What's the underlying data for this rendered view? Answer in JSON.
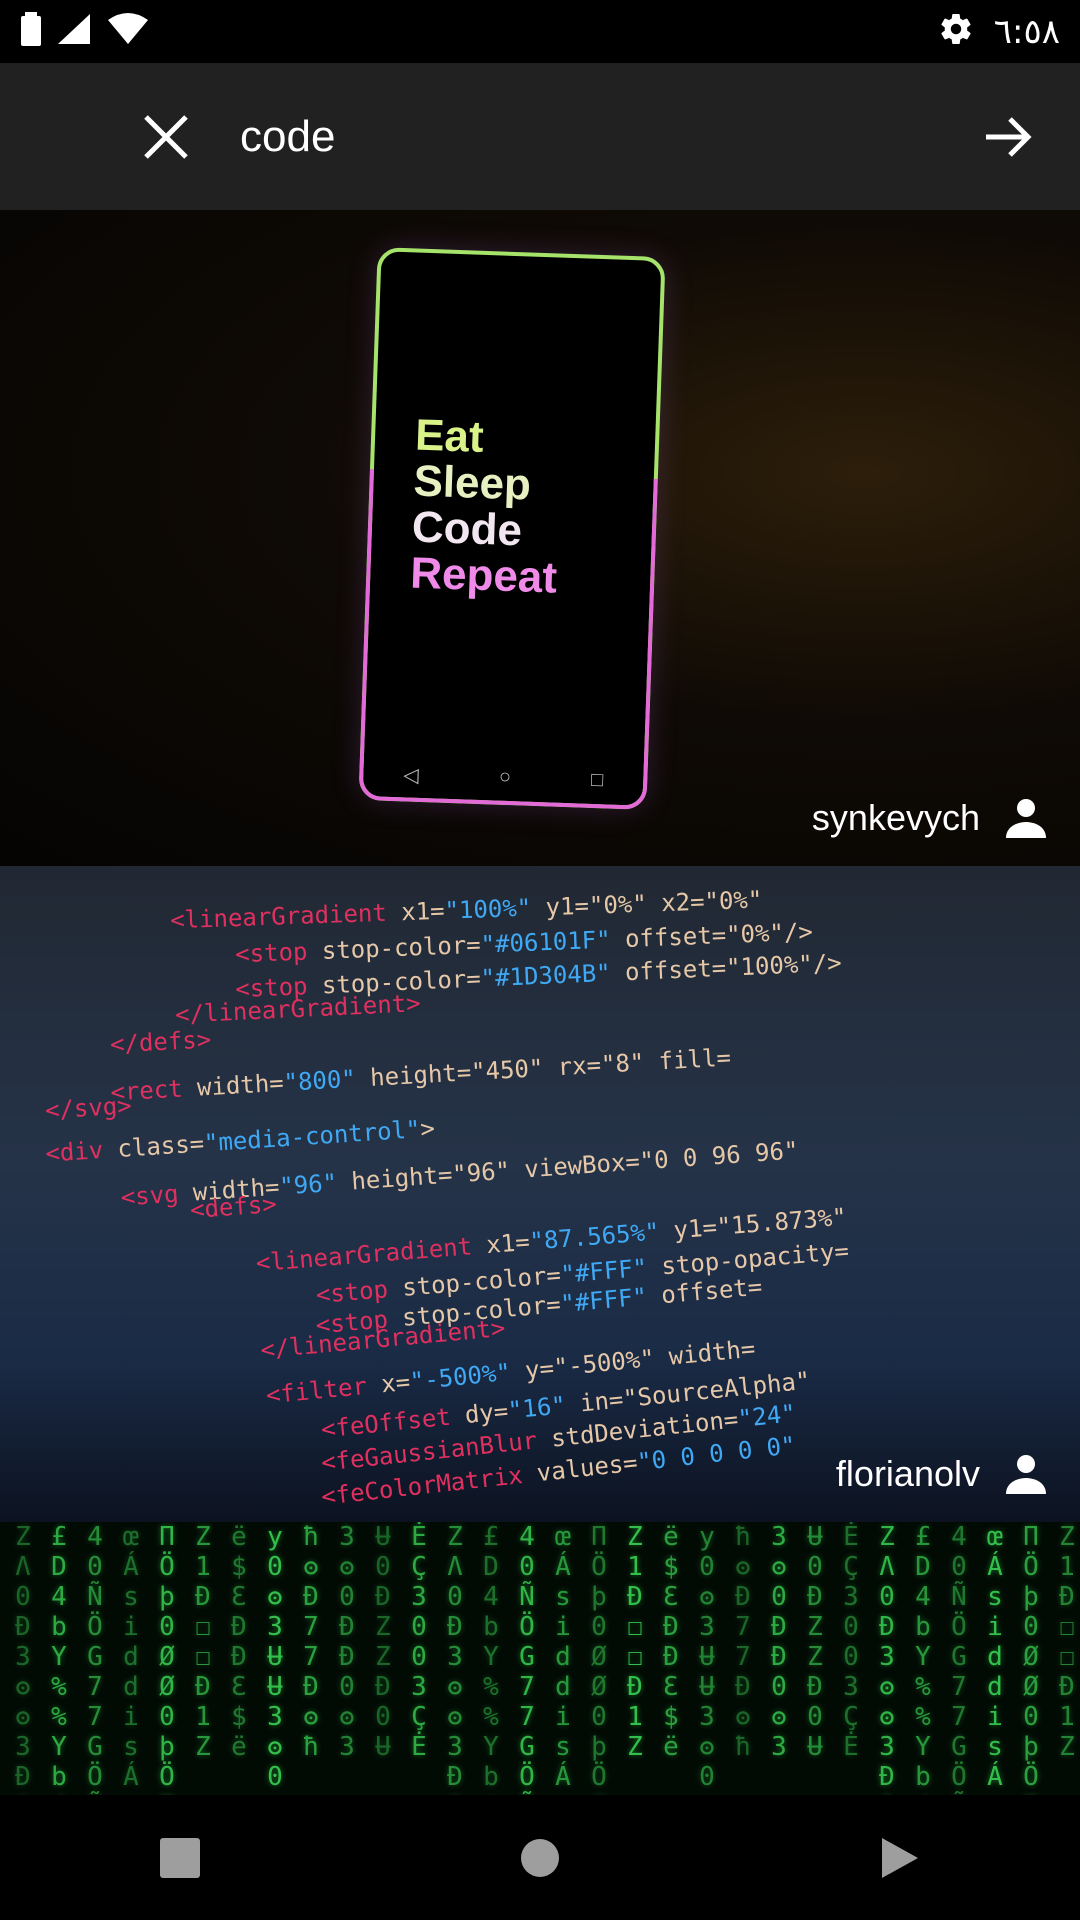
{
  "status_bar": {
    "time": "٦:٥٨",
    "icons": [
      "battery-icon",
      "signal-icon",
      "wifi-icon",
      "settings-icon"
    ]
  },
  "search": {
    "query": "code",
    "close_icon": "close-icon",
    "go_icon": "arrow-right-icon"
  },
  "results": [
    {
      "author": "synkevych",
      "image_text": [
        "Eat",
        "Sleep",
        "Code",
        "Repeat"
      ]
    },
    {
      "author": "florianolv",
      "code_lines": [
        {
          "tag": "<linearGradient",
          "attr": " x1=",
          "val": "\"100%\"",
          "rest": " y1=\"0%\" x2=\"0%\""
        },
        {
          "tag": "<stop",
          "attr": " stop-color=",
          "val": "\"#06101F\"",
          "rest": " offset=\"0%\"/>"
        },
        {
          "tag": "<stop",
          "attr": " stop-color=",
          "val": "\"#1D304B\"",
          "rest": " offset=\"100%\"/>"
        },
        {
          "tag": "</linearGradient>",
          "attr": "",
          "val": "",
          "rest": ""
        },
        {
          "tag": "</defs>",
          "attr": "",
          "val": "",
          "rest": ""
        },
        {
          "tag": "<rect",
          "attr": " width=",
          "val": "\"800\"",
          "rest": " height=\"450\" rx=\"8\" fill="
        },
        {
          "tag": "</svg>",
          "attr": "",
          "val": "",
          "rest": ""
        },
        {
          "tag": "<div",
          "attr": " class=",
          "val": "\"media-control\"",
          "rest": ">"
        },
        {
          "tag": "<svg",
          "attr": " width=",
          "val": "\"96\"",
          "rest": " height=\"96\" viewBox=\"0 0 96 96\""
        },
        {
          "tag": "<defs>",
          "attr": "",
          "val": "",
          "rest": ""
        },
        {
          "tag": "<linearGradient",
          "attr": " x1=",
          "val": "\"87.565%\"",
          "rest": " y1=\"15.873%\""
        },
        {
          "tag": "<stop",
          "attr": " stop-color=",
          "val": "\"#FFF\"",
          "rest": " stop-opacity="
        },
        {
          "tag": "<stop",
          "attr": " stop-color=",
          "val": "\"#FFF\"",
          "rest": " offset="
        },
        {
          "tag": "</linearGradient>",
          "attr": "",
          "val": "",
          "rest": ""
        },
        {
          "tag": "<filter",
          "attr": " x=",
          "val": "\"-500%\"",
          "rest": " y=\"-500%\" width="
        },
        {
          "tag": "<feOffset",
          "attr": " dy=",
          "val": "\"16\"",
          "rest": " in=\"SourceAlpha\""
        },
        {
          "tag": "<feGaussianBlur",
          "attr": " stdDeviation=",
          "val": "\"24\"",
          "rest": ""
        },
        {
          "tag": "<feColorMatrix",
          "attr": " values=",
          "val": "\"0 0 0 0 0\"",
          "rest": ""
        }
      ]
    },
    {
      "author": "",
      "matrix_columns": [
        "ZɅ0Ɖ3ʘ",
        "£D4bY%",
        "40ÑÖG7",
        "œÁsid",
        "ΠÖþ0Ø",
        "Z1Ð☐",
        "ë$ƐÐ",
        "y0ʘ3Ʉ",
        "ħʘÐ7",
        "3ʘ0Ɖ",
        "Ʉ0ÐZ",
        "ĖÇ30"
      ]
    }
  ],
  "nav_bar": {
    "icons": [
      "recents-square-icon",
      "home-circle-icon",
      "back-triangle-icon"
    ]
  }
}
